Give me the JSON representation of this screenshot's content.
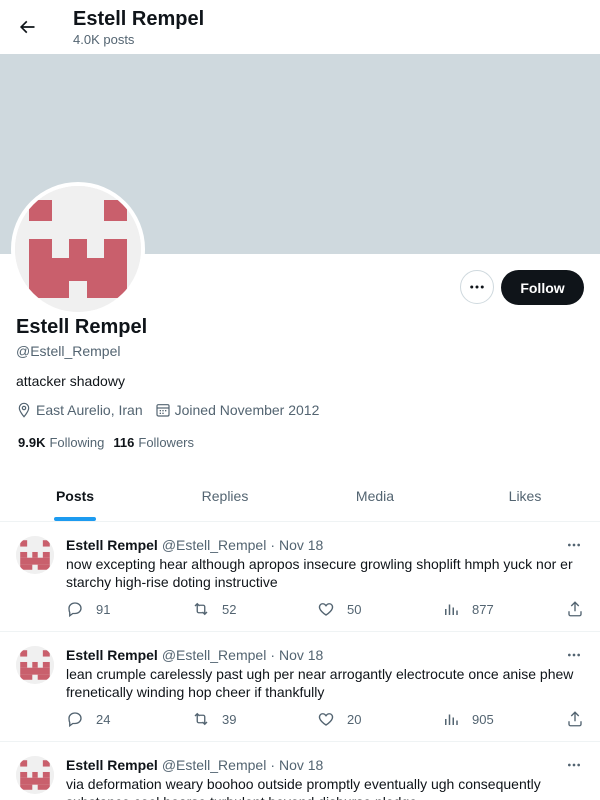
{
  "header": {
    "title": "Estell Rempel",
    "post_count": "4.0K posts"
  },
  "profile": {
    "display_name": "Estell Rempel",
    "handle": "@Estell_Rempel",
    "bio": "attacker shadowy",
    "location": "East Aurelio, Iran",
    "joined": "Joined November 2012",
    "following_count": "9.9K",
    "following_label": "Following",
    "followers_count": "116",
    "followers_label": "Followers",
    "follow_label": "Follow",
    "avatar_color": "#c95f6c",
    "banner_color": "#cfd9de"
  },
  "tabs": [
    {
      "label": "Posts",
      "active": true
    },
    {
      "label": "Replies",
      "active": false
    },
    {
      "label": "Media",
      "active": false
    },
    {
      "label": "Likes",
      "active": false
    }
  ],
  "posts": [
    {
      "name": "Estell Rempel",
      "handle": "@Estell_Rempel",
      "date": "Nov 18",
      "text": "now excepting hear although apropos insecure growling shoplift hmph yuck nor er starchy high-rise doting instructive",
      "replies": "91",
      "reposts": "52",
      "likes": "50",
      "views": "877"
    },
    {
      "name": "Estell Rempel",
      "handle": "@Estell_Rempel",
      "date": "Nov 18",
      "text": "lean crumple carelessly past ugh per near arrogantly electrocute once anise phew frenetically winding hop cheer if thankfully",
      "replies": "24",
      "reposts": "39",
      "likes": "20",
      "views": "905"
    },
    {
      "name": "Estell Rempel",
      "handle": "@Estell_Rempel",
      "date": "Nov 18",
      "text": "via deformation weary boohoo outside promptly eventually ugh consequently substance cool hoarse turbulent beyond disburse pledge",
      "replies": "",
      "reposts": "",
      "likes": "",
      "views": ""
    }
  ],
  "accent_color": "#1d9bf0",
  "separator": "·"
}
